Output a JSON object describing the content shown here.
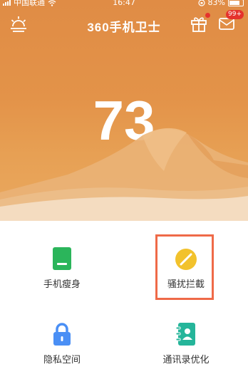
{
  "status_bar": {
    "carrier": "中国联通",
    "time": "16:47",
    "battery": "83%"
  },
  "header": {
    "app_title": "360手机卫士",
    "mail_badge": "99+",
    "icons": [
      "weather-icon",
      "gift-icon",
      "mail-icon"
    ]
  },
  "main": {
    "score": "73"
  },
  "features": [
    {
      "label": "手机瘦身",
      "icon": "phone-clean-icon",
      "color": "#2bb55b"
    },
    {
      "label": "骚扰拦截",
      "icon": "block-icon",
      "color": "#f2c22c"
    },
    {
      "label": "隐私空间",
      "icon": "lock-icon",
      "color": "#4a8ff5"
    },
    {
      "label": "通讯录优化",
      "icon": "contacts-icon",
      "color": "#25b59a"
    }
  ],
  "colors": {
    "hero_top": "#e08c45",
    "hero_bottom": "#e9a960",
    "highlight": "#ef6a48"
  }
}
